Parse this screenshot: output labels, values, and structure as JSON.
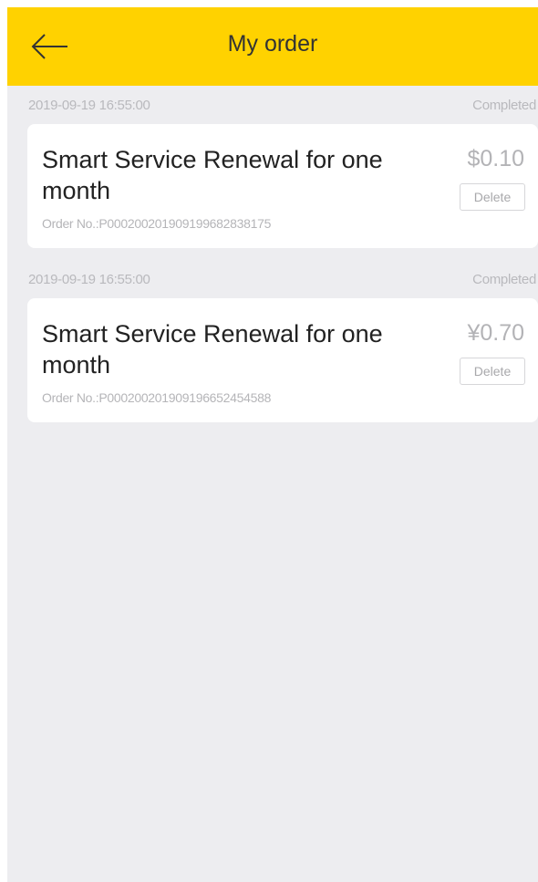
{
  "header": {
    "back_icon": "arrow-left-icon",
    "title": "My order"
  },
  "orders": [
    {
      "datetime": "2019-09-19 16:55:00",
      "status": "Completed",
      "name": "Smart Service Renewal for one month",
      "price": "$0.10",
      "delete_label": "Delete",
      "order_no": "Order No.:P00020020190919968283817​5"
    },
    {
      "datetime": "2019-09-19 16:55:00",
      "status": "Completed",
      "name": "Smart Service Renewal for one month",
      "price": "¥0.70",
      "delete_label": "Delete",
      "order_no": "Order No.:P000200201909196652454588"
    }
  ],
  "colors": {
    "header_bg": "#ffd200",
    "page_bg": "#ededf0"
  }
}
